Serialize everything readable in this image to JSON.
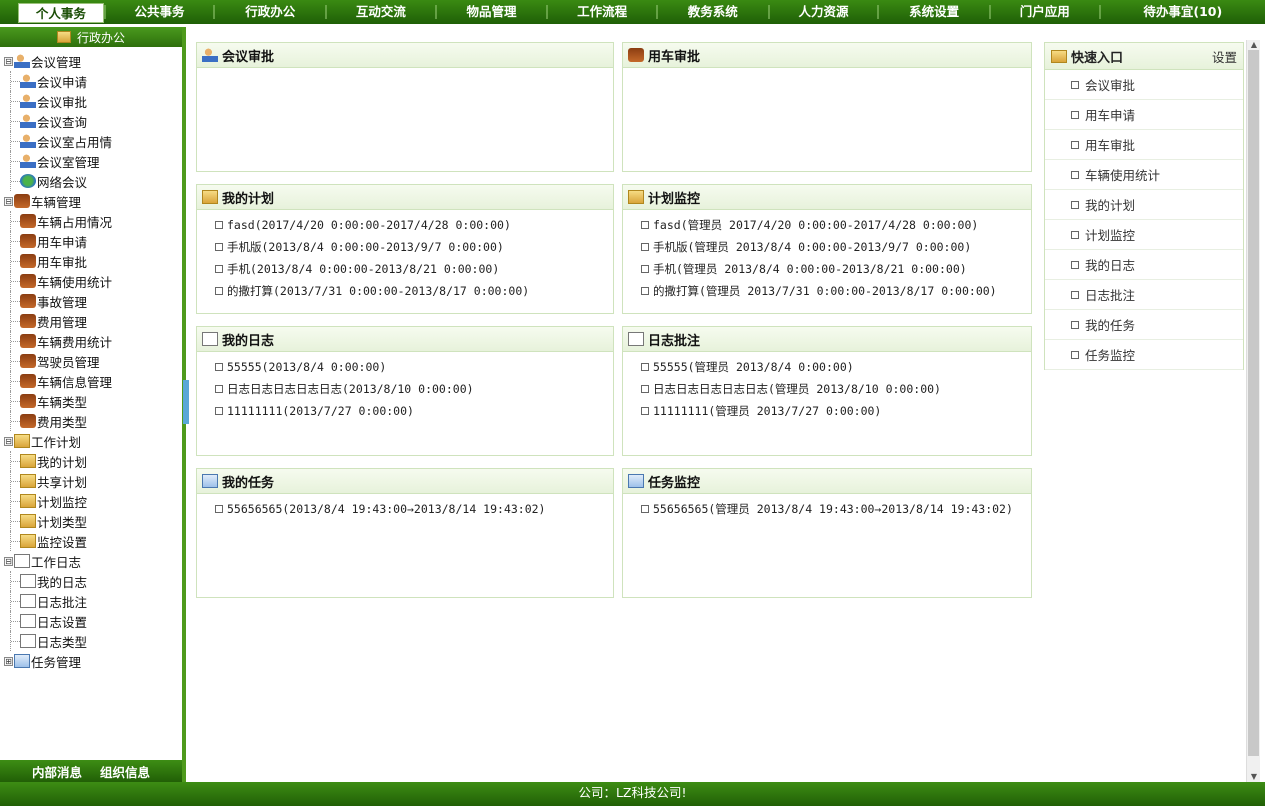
{
  "topnav": [
    "个人事务",
    "公共事务",
    "行政办公",
    "互动交流",
    "物品管理",
    "工作流程",
    "教务系统",
    "人力资源",
    "系统设置",
    "门户应用",
    "待办事宜(10)"
  ],
  "sidebar": {
    "title": "行政办公",
    "groups": [
      {
        "label": "会议管理",
        "toggle": "⊟",
        "icon": "ic-people",
        "children": [
          [
            "会议申请",
            "ic-people"
          ],
          [
            "会议审批",
            "ic-people"
          ],
          [
            "会议查询",
            "ic-people"
          ],
          [
            "会议室占用情",
            "ic-people"
          ],
          [
            "会议室管理",
            "ic-people"
          ],
          [
            "网络会议",
            "ic-globe"
          ]
        ]
      },
      {
        "label": "车辆管理",
        "toggle": "⊟",
        "icon": "ic-car",
        "children": [
          [
            "车辆占用情况",
            "ic-car"
          ],
          [
            "用车申请",
            "ic-car"
          ],
          [
            "用车审批",
            "ic-car"
          ],
          [
            "车辆使用统计",
            "ic-car"
          ],
          [
            "事故管理",
            "ic-car"
          ],
          [
            "费用管理",
            "ic-car"
          ],
          [
            "车辆费用统计",
            "ic-car"
          ],
          [
            "驾驶员管理",
            "ic-car"
          ],
          [
            "车辆信息管理",
            "ic-car"
          ],
          [
            "车辆类型",
            "ic-car"
          ],
          [
            "费用类型",
            "ic-car"
          ]
        ]
      },
      {
        "label": "工作计划",
        "toggle": "⊟",
        "icon": "ic-folder",
        "children": [
          [
            "我的计划",
            "ic-folder"
          ],
          [
            "共享计划",
            "ic-folder"
          ],
          [
            "计划监控",
            "ic-folder"
          ],
          [
            "计划类型",
            "ic-folder"
          ],
          [
            "监控设置",
            "ic-folder"
          ]
        ]
      },
      {
        "label": "工作日志",
        "toggle": "⊟",
        "icon": "ic-doc",
        "children": [
          [
            "我的日志",
            "ic-doc"
          ],
          [
            "日志批注",
            "ic-doc"
          ],
          [
            "日志设置",
            "ic-doc"
          ],
          [
            "日志类型",
            "ic-doc"
          ]
        ]
      },
      {
        "label": "任务管理",
        "toggle": "⊞",
        "icon": "ic-task",
        "children": []
      }
    ],
    "footer": [
      "内部消息",
      "组织信息"
    ]
  },
  "panels": [
    {
      "title": "会议审批",
      "icon": "ic-people",
      "items": []
    },
    {
      "title": "用车审批",
      "icon": "ic-car",
      "items": []
    },
    {
      "title": "我的计划",
      "icon": "ic-folder",
      "items": [
        "fasd(2017/4/20 0:00:00-2017/4/28 0:00:00)",
        "手机版(2013/8/4 0:00:00-2013/9/7 0:00:00)",
        "手机(2013/8/4 0:00:00-2013/8/21 0:00:00)",
        "的撒打算(2013/7/31 0:00:00-2013/8/17 0:00:00)"
      ]
    },
    {
      "title": "计划监控",
      "icon": "ic-folder",
      "items": [
        "fasd(管理员 2017/4/20 0:00:00-2017/4/28 0:00:00)",
        "手机版(管理员 2013/8/4 0:00:00-2013/9/7 0:00:00)",
        "手机(管理员 2013/8/4 0:00:00-2013/8/21 0:00:00)",
        "的撒打算(管理员 2013/7/31 0:00:00-2013/8/17 0:00:00)"
      ]
    },
    {
      "title": "我的日志",
      "icon": "ic-doc",
      "items": [
        "55555(2013/8/4 0:00:00)",
        "日志日志日志日志日志(2013/8/10 0:00:00)",
        "11111111(2013/7/27 0:00:00)"
      ]
    },
    {
      "title": "日志批注",
      "icon": "ic-doc",
      "items": [
        "55555(管理员 2013/8/4 0:00:00)",
        "日志日志日志日志日志(管理员 2013/8/10 0:00:00)",
        "11111111(管理员 2013/7/27 0:00:00)"
      ]
    },
    {
      "title": "我的任务",
      "icon": "ic-task",
      "items": [
        "55656565(2013/8/4 19:43:00→2013/8/14 19:43:02)"
      ]
    },
    {
      "title": "任务监控",
      "icon": "ic-task",
      "items": [
        "55656565(管理员 2013/8/4 19:43:00→2013/8/14 19:43:02)"
      ]
    }
  ],
  "quick": {
    "title": "快速入口",
    "settings": "设置",
    "items": [
      "会议审批",
      "用车申请",
      "用车审批",
      "车辆使用统计",
      "我的计划",
      "计划监控",
      "我的日志",
      "日志批注",
      "我的任务",
      "任务监控"
    ]
  },
  "footer": "公司：LZ科技公司!"
}
